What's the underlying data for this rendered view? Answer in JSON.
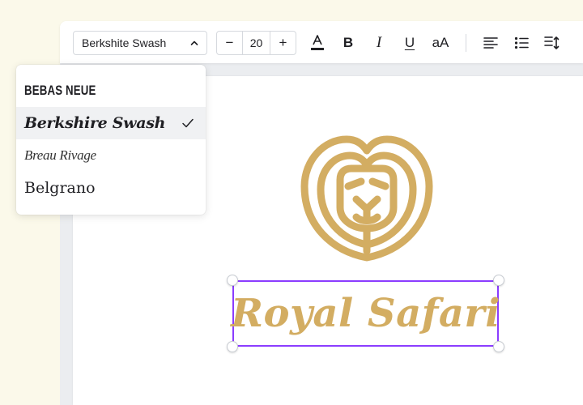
{
  "toolbar": {
    "font_name": "Berkshite Swash",
    "font_size": "20",
    "decrease_label": "−",
    "increase_label": "+",
    "text_color_icon": "text-color-icon",
    "bold_label": "B",
    "italic_label": "I",
    "underline_label": "U",
    "case_label": "aA",
    "text_color": "#1f1f23"
  },
  "font_menu": {
    "items": [
      {
        "label": "BEBAS NEUE",
        "selected": false
      },
      {
        "label": "Berkshire Swash",
        "selected": true
      },
      {
        "label": "Breau Rivage",
        "selected": false
      },
      {
        "label": "Belgrano",
        "selected": false
      }
    ]
  },
  "design": {
    "title": "Royal Safari",
    "gold": "#d3ad62",
    "selection_color": "#8b3dff"
  }
}
